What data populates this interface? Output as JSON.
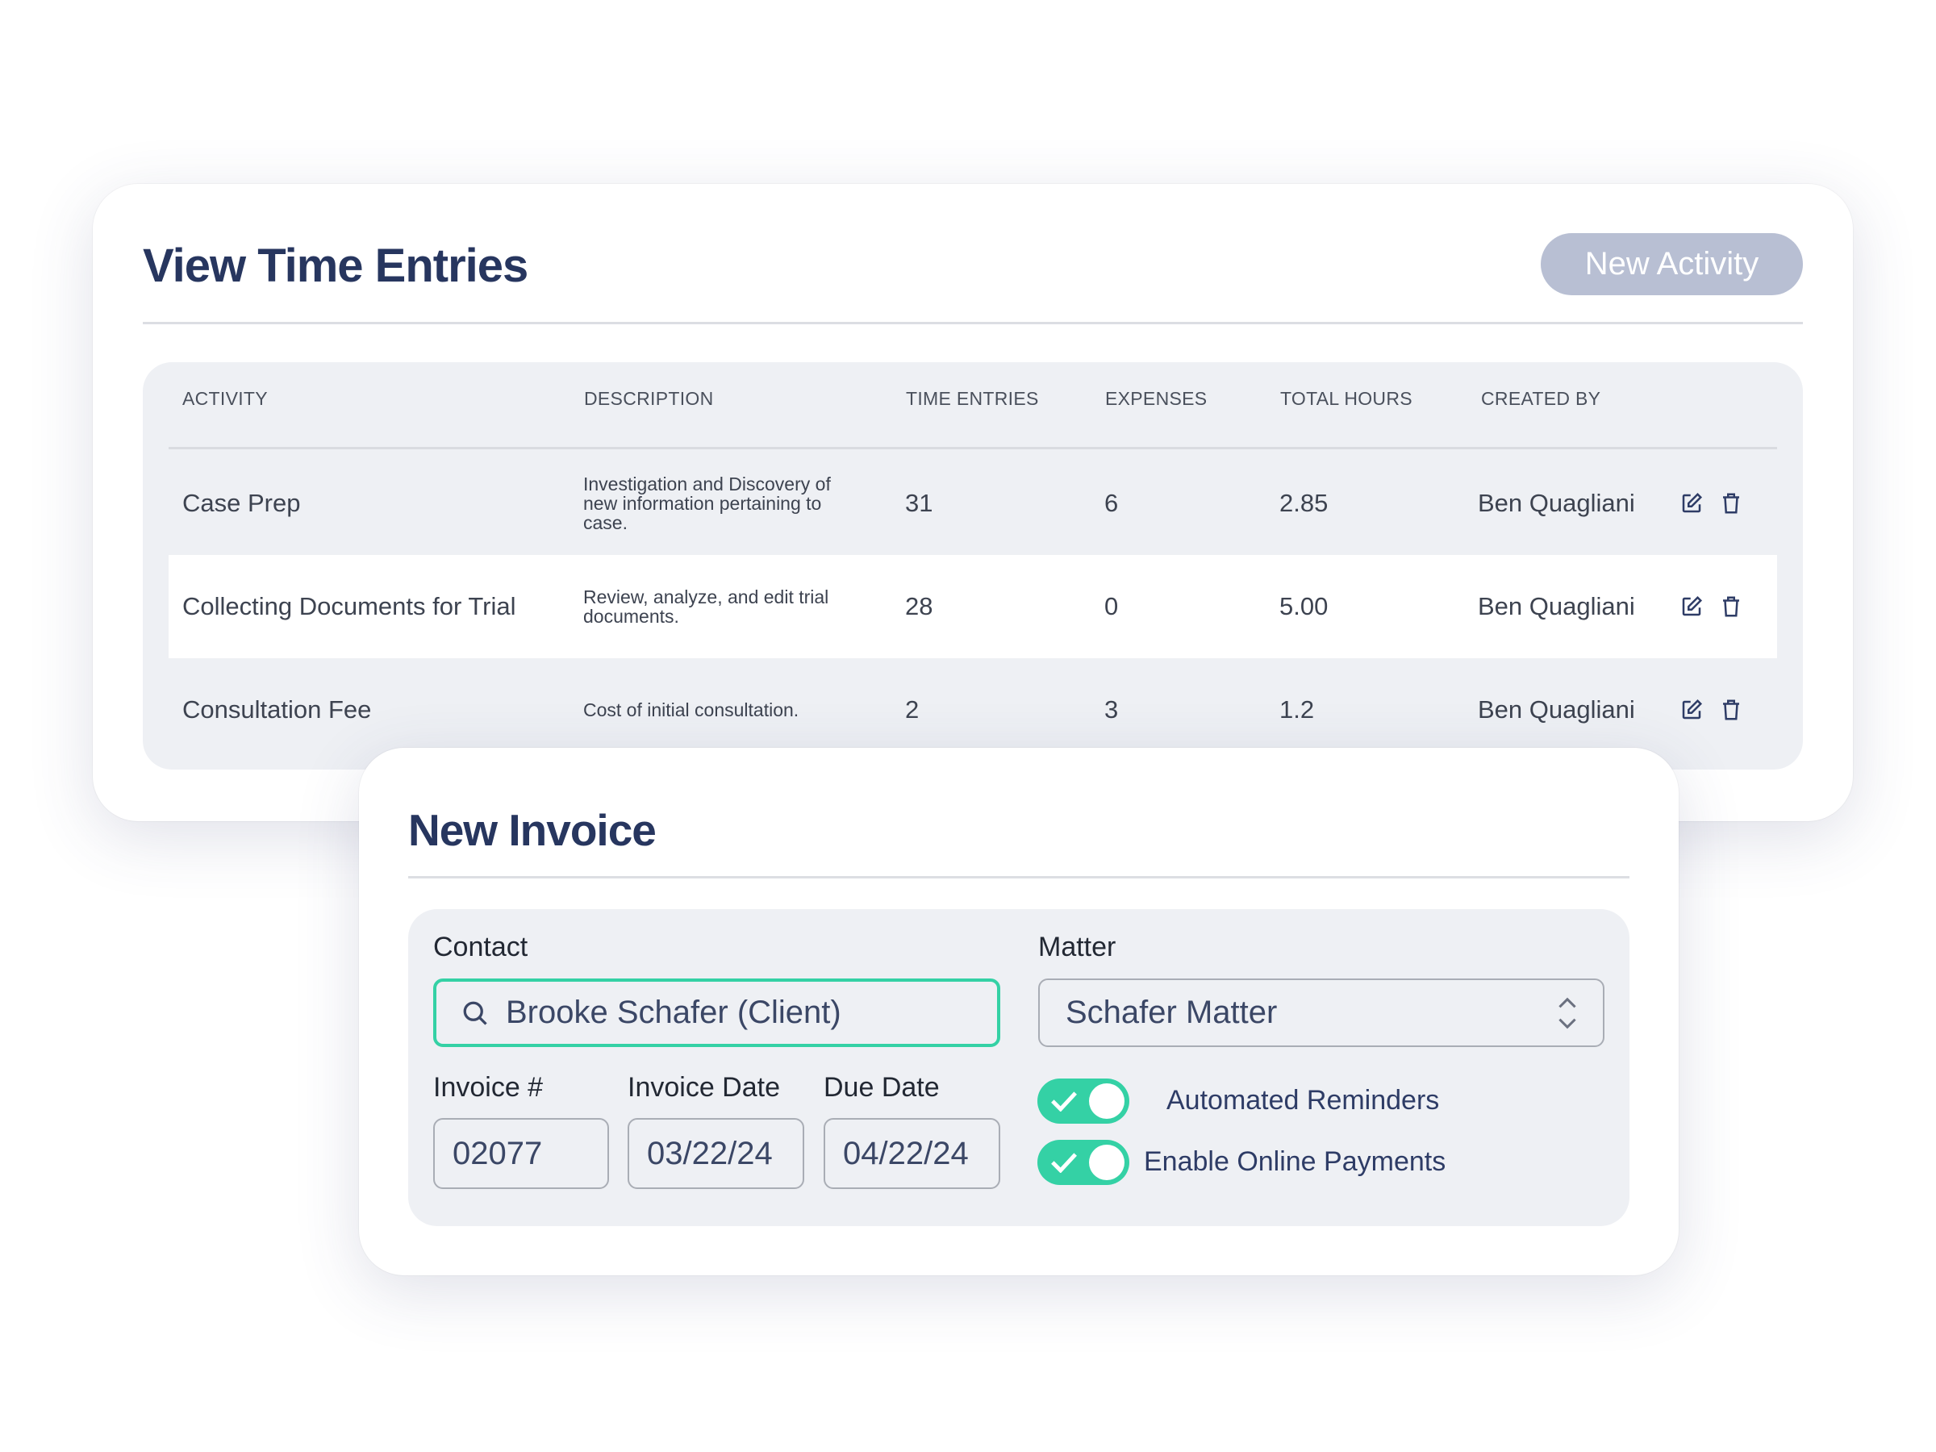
{
  "time_entries": {
    "title": "View Time Entries",
    "new_activity_label": "New Activity",
    "columns": [
      "ACTIVITY",
      "DESCRIPTION",
      "TIME ENTRIES",
      "EXPENSES",
      "TOTAL HOURS",
      "CREATED BY"
    ],
    "rows": [
      {
        "activity": "Case Prep",
        "description": "Investigation and Discovery of new information pertaining to case.",
        "time_entries": "31",
        "expenses": "6",
        "total_hours": "2.85",
        "created_by": "Ben Quagliani"
      },
      {
        "activity": "Collecting Documents for Trial",
        "description": "Review, analyze, and edit trial documents.",
        "time_entries": "28",
        "expenses": "0",
        "total_hours": "5.00",
        "created_by": "Ben Quagliani"
      },
      {
        "activity": "Consultation Fee",
        "description": "Cost of initial consultation.",
        "time_entries": "2",
        "expenses": "3",
        "total_hours": "1.2",
        "created_by": "Ben Quagliani"
      }
    ]
  },
  "invoice": {
    "title": "New Invoice",
    "contact_label": "Contact",
    "contact_value": "Brooke Schafer (Client)",
    "matter_label": "Matter",
    "matter_value": "Schafer Matter",
    "invoice_no_label": "Invoice #",
    "invoice_no": "02077",
    "invoice_date_label": "Invoice Date",
    "invoice_date": "03/22/24",
    "due_date_label": "Due Date",
    "due_date": "04/22/24",
    "toggles": [
      {
        "label": "Automated Reminders",
        "on": true
      },
      {
        "label": "Enable Online Payments",
        "on": true
      }
    ]
  },
  "colors": {
    "accent": "#34d1a5",
    "title": "#27365f",
    "button": "#b8bfd3"
  }
}
